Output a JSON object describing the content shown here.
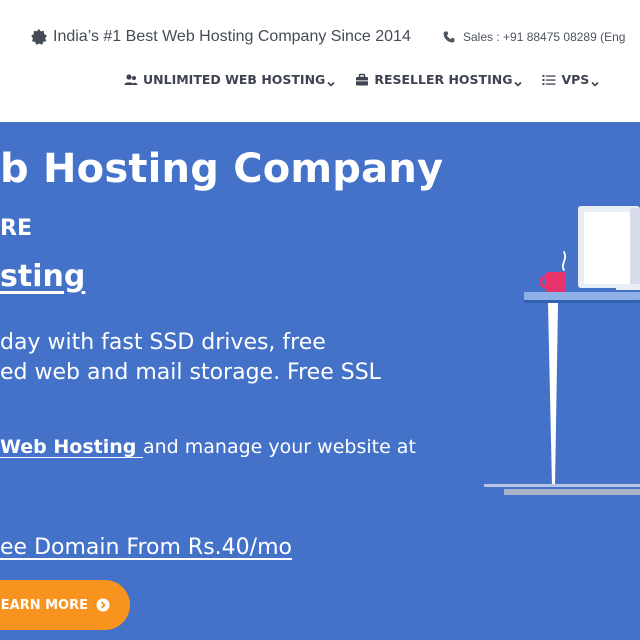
{
  "topbar": {
    "tagline": "India’s #1 Best Web Hosting Company Since 2014",
    "sales": "Sales : +91 88475 08289 (Eng"
  },
  "nav": {
    "items": [
      {
        "label": "UNLIMITED WEB HOSTING",
        "icon": "users-icon"
      },
      {
        "label": "RESELLER HOSTING",
        "icon": "briefcase-icon"
      },
      {
        "label": "VPS",
        "icon": "list-icon"
      }
    ]
  },
  "hero": {
    "title": "b Hosting Company",
    "subtitle": "RE",
    "product": "sting",
    "desc_line1": "day with fast SSD drives, free",
    "desc_line2": "ed web and mail storage. Free SSL",
    "cta_link": " Web Hosting ",
    "cta_rest": "and manage your website at",
    "domain_link": "ee Domain From Rs.40/mo",
    "button_label": "EARN MORE"
  },
  "colors": {
    "hero_bg": "#4472c9",
    "button_bg": "#f7931e",
    "nav_text": "#3d4350"
  }
}
